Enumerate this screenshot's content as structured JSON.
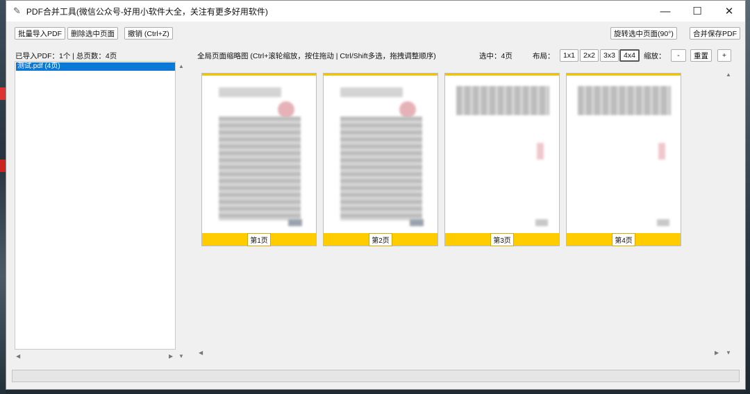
{
  "window": {
    "title": "PDF合并工具(微信公众号-好用小软件大全，关注有更多好用软件)",
    "controls": [
      "—",
      "☐",
      "✕"
    ]
  },
  "toolbar": {
    "import_label": "批量导入PDF",
    "delete_label": "删除选中页面",
    "undo_label": "撤销 (Ctrl+Z)",
    "rotate_label": "旋转选中页面(90°)",
    "merge_label": "合并保存PDF"
  },
  "files": {
    "summary": "已导入PDF：1个 | 总页数：4页",
    "items": [
      "测试.pdf (4页)"
    ]
  },
  "preview": {
    "hint": "全局页面缩略图 (Ctrl+滚轮缩放，按住拖动 | Ctrl/Shift多选，拖拽调整顺序)",
    "selected": "选中：4页",
    "layout_label": "布局：",
    "layouts": [
      "1x1",
      "2x2",
      "3x3",
      "4x4"
    ],
    "active_layout": "4x4",
    "zoom_label": "缩放：",
    "zoom_out": "-",
    "reset_label": "重置",
    "zoom_in": "+",
    "pages": [
      "第1页",
      "第2页",
      "第3页",
      "第4页"
    ]
  }
}
